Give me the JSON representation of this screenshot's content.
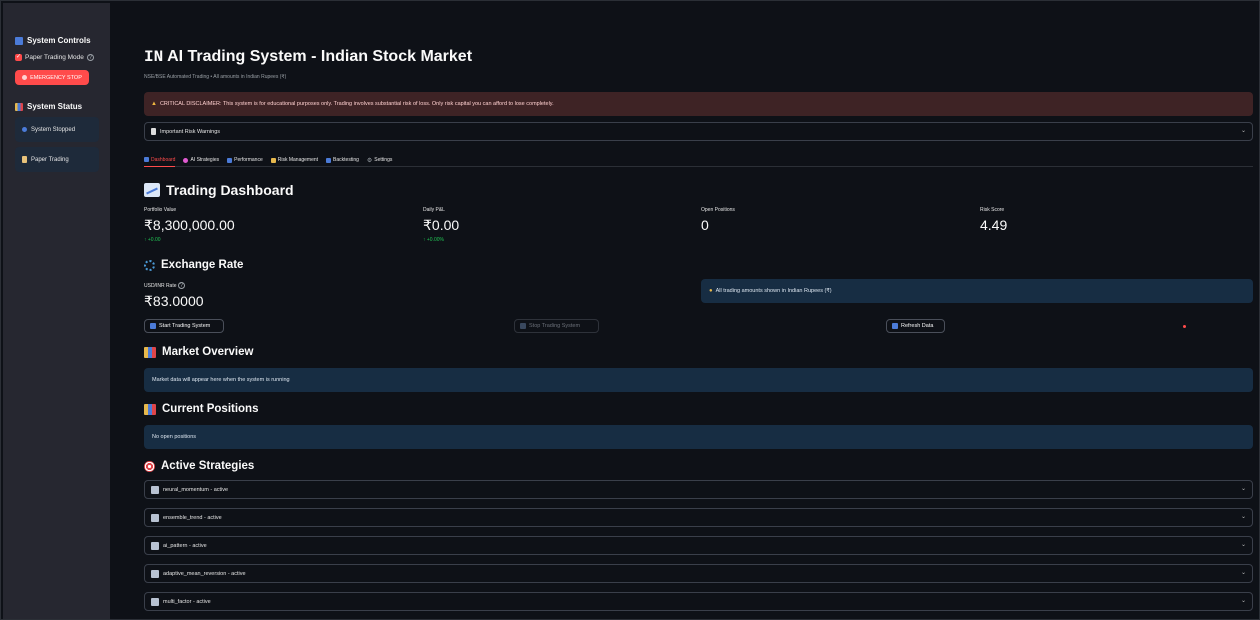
{
  "sidebar": {
    "controls_title": "System Controls",
    "paper_mode_label": "Paper Trading Mode",
    "emergency_label": "EMERGENCY STOP",
    "status_title": "System Status",
    "system_state": "System Stopped",
    "trading_mode": "Paper Trading"
  },
  "header": {
    "flag": "IN",
    "title": "AI Trading System - Indian Stock Market",
    "subtitle": "NSE/BSE Automated Trading • All amounts in Indian Rupees (₹)"
  },
  "disclaimer": "CRITICAL DISCLAIMER: This system is for educational purposes only. Trading involves substantial risk of loss. Only risk capital you can afford to lose completely.",
  "risk_expander": "Important Risk Warnings",
  "tabs": [
    {
      "label": "Dashboard",
      "color": "#4b7bd8"
    },
    {
      "label": "AI Strategies",
      "color": "#e05ad0"
    },
    {
      "label": "Performance",
      "color": "#4b7bd8"
    },
    {
      "label": "Risk Management",
      "color": "#e6b84d"
    },
    {
      "label": "Backtesting",
      "color": "#4b7bd8"
    },
    {
      "label": "Settings",
      "color": "#9aa0a6"
    }
  ],
  "dashboard": {
    "title": "Trading Dashboard",
    "metrics": [
      {
        "label": "Portfolio Value",
        "value": "₹8,300,000.00",
        "delta": "↑ +0.00"
      },
      {
        "label": "Daily P&L",
        "value": "₹0.00",
        "delta": "↑ +0.00%"
      },
      {
        "label": "Open Positions",
        "value": "0",
        "delta": ""
      },
      {
        "label": "Risk Score",
        "value": "4.49",
        "delta": ""
      }
    ]
  },
  "exchange": {
    "title": "Exchange Rate",
    "rate_label": "USD/INR Rate",
    "rate_value": "₹83.0000",
    "info": "All trading amounts shown in Indian Rupees (₹)"
  },
  "buttons": {
    "start": "Start Trading System",
    "stop": "Stop Trading System",
    "refresh": "Refresh Data"
  },
  "market": {
    "title": "Market Overview",
    "info": "Market data will appear here when the system is running"
  },
  "positions": {
    "title": "Current Positions",
    "info": "No open positions"
  },
  "strategies": {
    "title": "Active Strategies",
    "items": [
      "neural_momentum - active",
      "ensemble_trend - active",
      "ai_pattern - active",
      "adaptive_mean_reversion - active",
      "multi_factor - active"
    ]
  },
  "colors": {
    "accent": "#ff4b4b",
    "info_bg": "#172d43",
    "error_bg": "#3e2325",
    "positive": "#21c354"
  }
}
